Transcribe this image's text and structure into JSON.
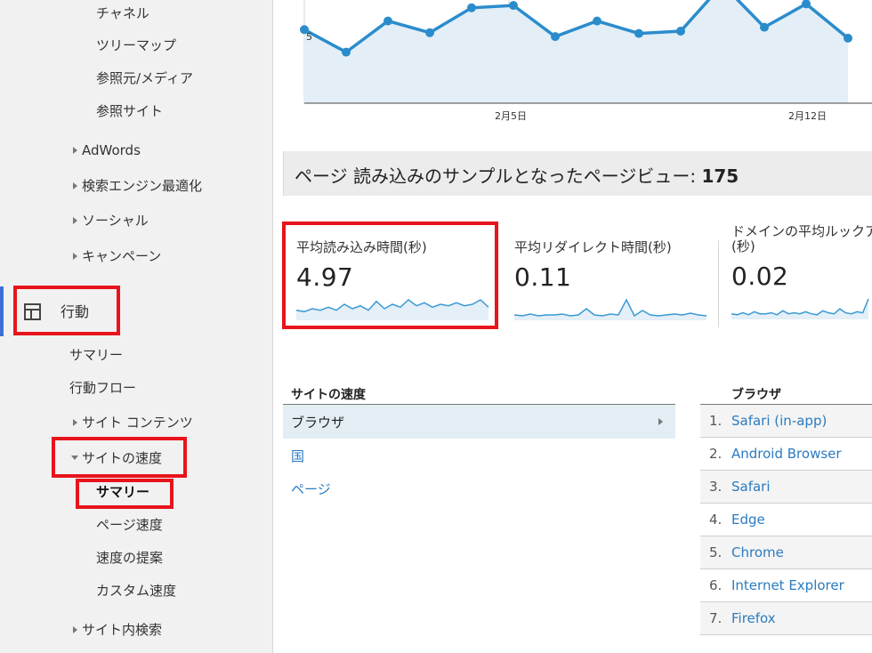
{
  "sidebar": {
    "items": [
      {
        "label": "チャネル"
      },
      {
        "label": "ツリーマップ"
      },
      {
        "label": "参照元/メディア"
      },
      {
        "label": "参照サイト"
      },
      {
        "label": "AdWords"
      },
      {
        "label": "検索エンジン最適化"
      },
      {
        "label": "ソーシャル"
      },
      {
        "label": "キャンペーン"
      }
    ],
    "behavior": {
      "label": "行動",
      "icon": "layout-icon",
      "items": [
        {
          "label": "サマリー"
        },
        {
          "label": "行動フロー"
        },
        {
          "label": "サイト コンテンツ"
        },
        {
          "label": "サイトの速度"
        },
        {
          "label": "サマリー"
        },
        {
          "label": "ページ速度"
        },
        {
          "label": "速度の提案"
        },
        {
          "label": "カスタム速度"
        },
        {
          "label": "サイト内検索"
        }
      ]
    }
  },
  "chart_data": {
    "type": "line",
    "y_tick": "5",
    "x_ticks": [
      "2月5日",
      "2月12日"
    ],
    "values": [
      5.02,
      4.73,
      5.13,
      4.98,
      5.3,
      5.33,
      4.93,
      5.13,
      4.97,
      5.0,
      5.6,
      5.05,
      5.35,
      4.91
    ],
    "color": "#2b8ccc",
    "fill": "#e3eef7"
  },
  "sample": {
    "label": "ページ 読み込みのサンプルとなったページビュー: ",
    "value": "175"
  },
  "metrics": [
    {
      "label": "平均読み込み時間(秒)",
      "value": "4.97",
      "spark": [
        5,
        4,
        6,
        5,
        7,
        5,
        9,
        6,
        8,
        5,
        11,
        6,
        9,
        7,
        12,
        8,
        10,
        7,
        9,
        8,
        10,
        8,
        9,
        12,
        7
      ]
    },
    {
      "label": "平均リダイレクト時間(秒)",
      "value": "0.11",
      "spark": [
        3,
        2,
        4,
        2,
        3,
        3,
        4,
        2,
        3,
        10,
        3,
        2,
        4,
        3,
        20,
        2,
        8,
        3,
        2,
        3,
        4,
        3,
        5,
        3,
        2
      ]
    },
    {
      "label_1": "ドメインの平均ルックア",
      "label_2": "(秒)",
      "value": "0.02",
      "spark": [
        3,
        2,
        4,
        2,
        5,
        3,
        3,
        4,
        2,
        6,
        3,
        4,
        3,
        5,
        3,
        2,
        6,
        4,
        3,
        8,
        4,
        3,
        5,
        4,
        18
      ]
    }
  ],
  "site_speed": {
    "title": "サイトの速度",
    "selected": "ブラウザ",
    "links": [
      "国",
      "ページ"
    ]
  },
  "browser": {
    "title": "ブラウザ",
    "rows": [
      {
        "num": "1.",
        "name": "Safari (in-app)"
      },
      {
        "num": "2.",
        "name": "Android Browser"
      },
      {
        "num": "3.",
        "name": "Safari"
      },
      {
        "num": "4.",
        "name": "Edge"
      },
      {
        "num": "5.",
        "name": "Chrome"
      },
      {
        "num": "6.",
        "name": "Internet Explorer"
      },
      {
        "num": "7.",
        "name": "Firefox"
      }
    ]
  }
}
